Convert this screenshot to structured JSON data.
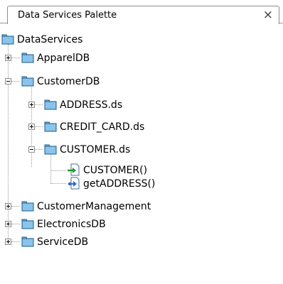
{
  "panel": {
    "title": "Data Services Palette",
    "close_symbol": "×"
  },
  "tree": {
    "root": "DataServices",
    "nodes": [
      {
        "label": "ApparelDB",
        "toggle": "plus",
        "icon": "folder-icon"
      },
      {
        "label": "CustomerDB",
        "toggle": "minus",
        "icon": "folder-icon"
      },
      {
        "label": "ADDRESS.ds",
        "toggle": "plus",
        "icon": "folder-icon"
      },
      {
        "label": "CREDIT_CARD.ds",
        "toggle": "plus",
        "icon": "folder-icon"
      },
      {
        "label": "CUSTOMER.ds",
        "toggle": "minus",
        "icon": "folder-icon"
      },
      {
        "label": "CUSTOMER()",
        "icon": "read-function-icon"
      },
      {
        "label": "getADDRESS()",
        "icon": "navigate-function-icon"
      },
      {
        "label": "CustomerManagement",
        "toggle": "plus",
        "icon": "folder-icon"
      },
      {
        "label": "ElectronicsDB",
        "toggle": "plus",
        "icon": "folder-icon"
      },
      {
        "label": "ServiceDB",
        "toggle": "plus",
        "icon": "folder-icon"
      }
    ]
  },
  "colors": {
    "folder_fill": "#8ac4ea",
    "folder_edge": "#1b5a8a",
    "arrow_green": "#1a9a2a",
    "arrow_blue": "#2a6acc"
  }
}
